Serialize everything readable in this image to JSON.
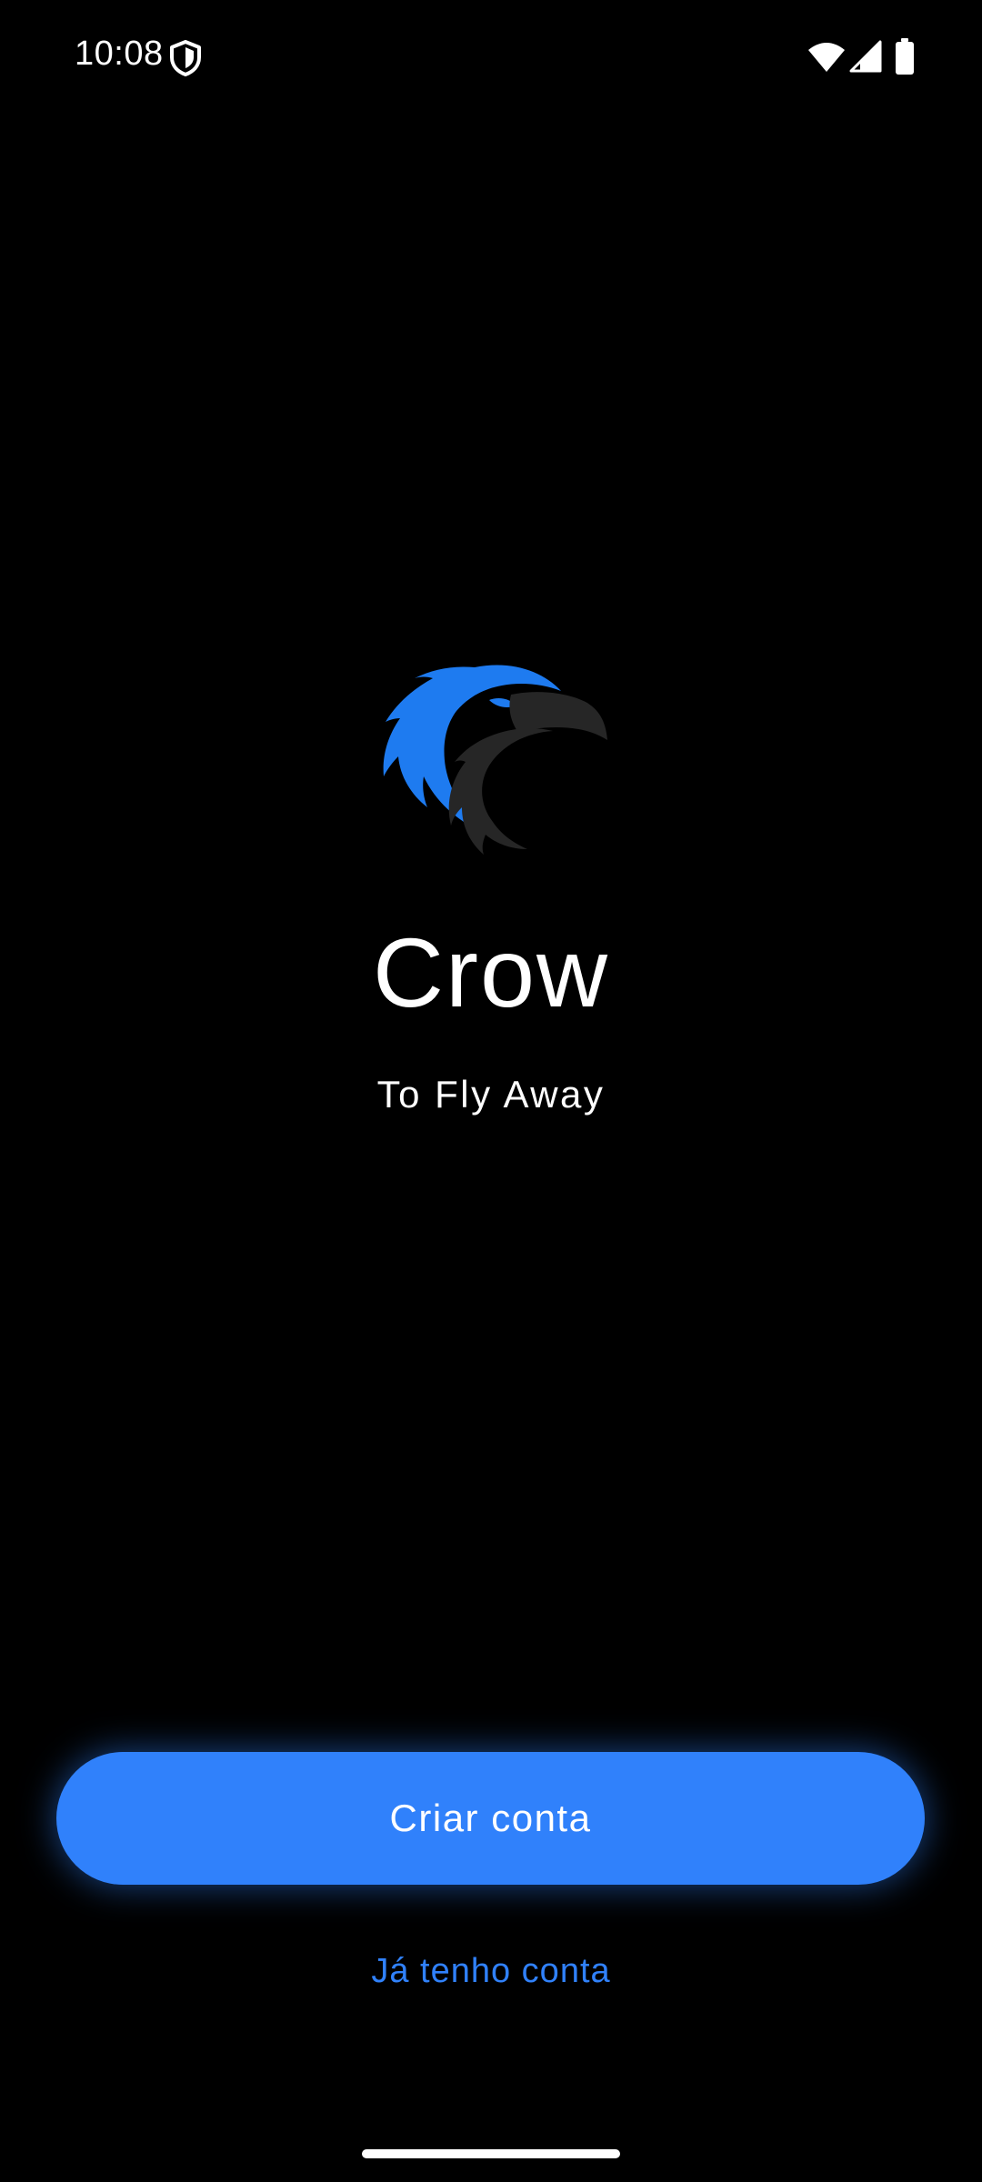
{
  "status_bar": {
    "time": "10:08",
    "icons": [
      "shield-icon",
      "wifi-icon",
      "signal-icon",
      "battery-icon"
    ]
  },
  "app": {
    "name": "Crow",
    "tagline": "To Fly Away",
    "logo_icon": "crow-logo-icon"
  },
  "actions": {
    "create_account_label": "Criar conta",
    "have_account_label": "Já tenho conta"
  },
  "colors": {
    "background": "#000000",
    "accent": "#3081fb",
    "logo_blue": "#1e7bf0",
    "logo_dark": "#262626",
    "text": "#ffffff"
  }
}
